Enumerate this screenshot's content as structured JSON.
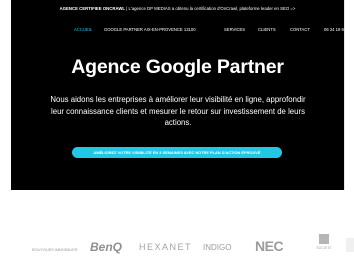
{
  "topbar": {
    "badge": "AGENCE CERTIFIEE ONCRAWL",
    "text": " | L'agence DP MEDIAS a obtenu la certification d'OnCrawl, plateforme leader en SEO =>"
  },
  "nav": {
    "items": [
      {
        "label": "ACCUEIL",
        "active": true
      },
      {
        "label": "GOOGLE PARTNER AIX-EN-PROVENCE 13100",
        "active": false
      },
      {
        "label": "SERVICES",
        "active": false
      },
      {
        "label": "CLIENTS",
        "active": false
      },
      {
        "label": "CONTACT",
        "active": false
      },
      {
        "label": "06 24 19 60",
        "active": false
      }
    ]
  },
  "hero": {
    "title": "Agence Google Partner",
    "subtitle": "Nous aidons les entreprises à améliorer leur visibilité en ligne, approfondir leur connaissance clients et mesurer le retour sur investissement de leurs actions.",
    "cta": "AMÉLIOREZ VOTRE VISIBILITÉ EN 3 SEMAINES AVEC NOTRE PLAN D'ACTION ÉPROUVÉ"
  },
  "colors": {
    "accent": "#22c7e6",
    "background": "#000000"
  },
  "logos": [
    {
      "name": "BOUYGUES IMMOBILIER"
    },
    {
      "name": "BenQ"
    },
    {
      "name": "HEXANET"
    },
    {
      "name": "INDIGO"
    },
    {
      "name": "NEC"
    },
    {
      "name": "SOCIETE"
    }
  ]
}
